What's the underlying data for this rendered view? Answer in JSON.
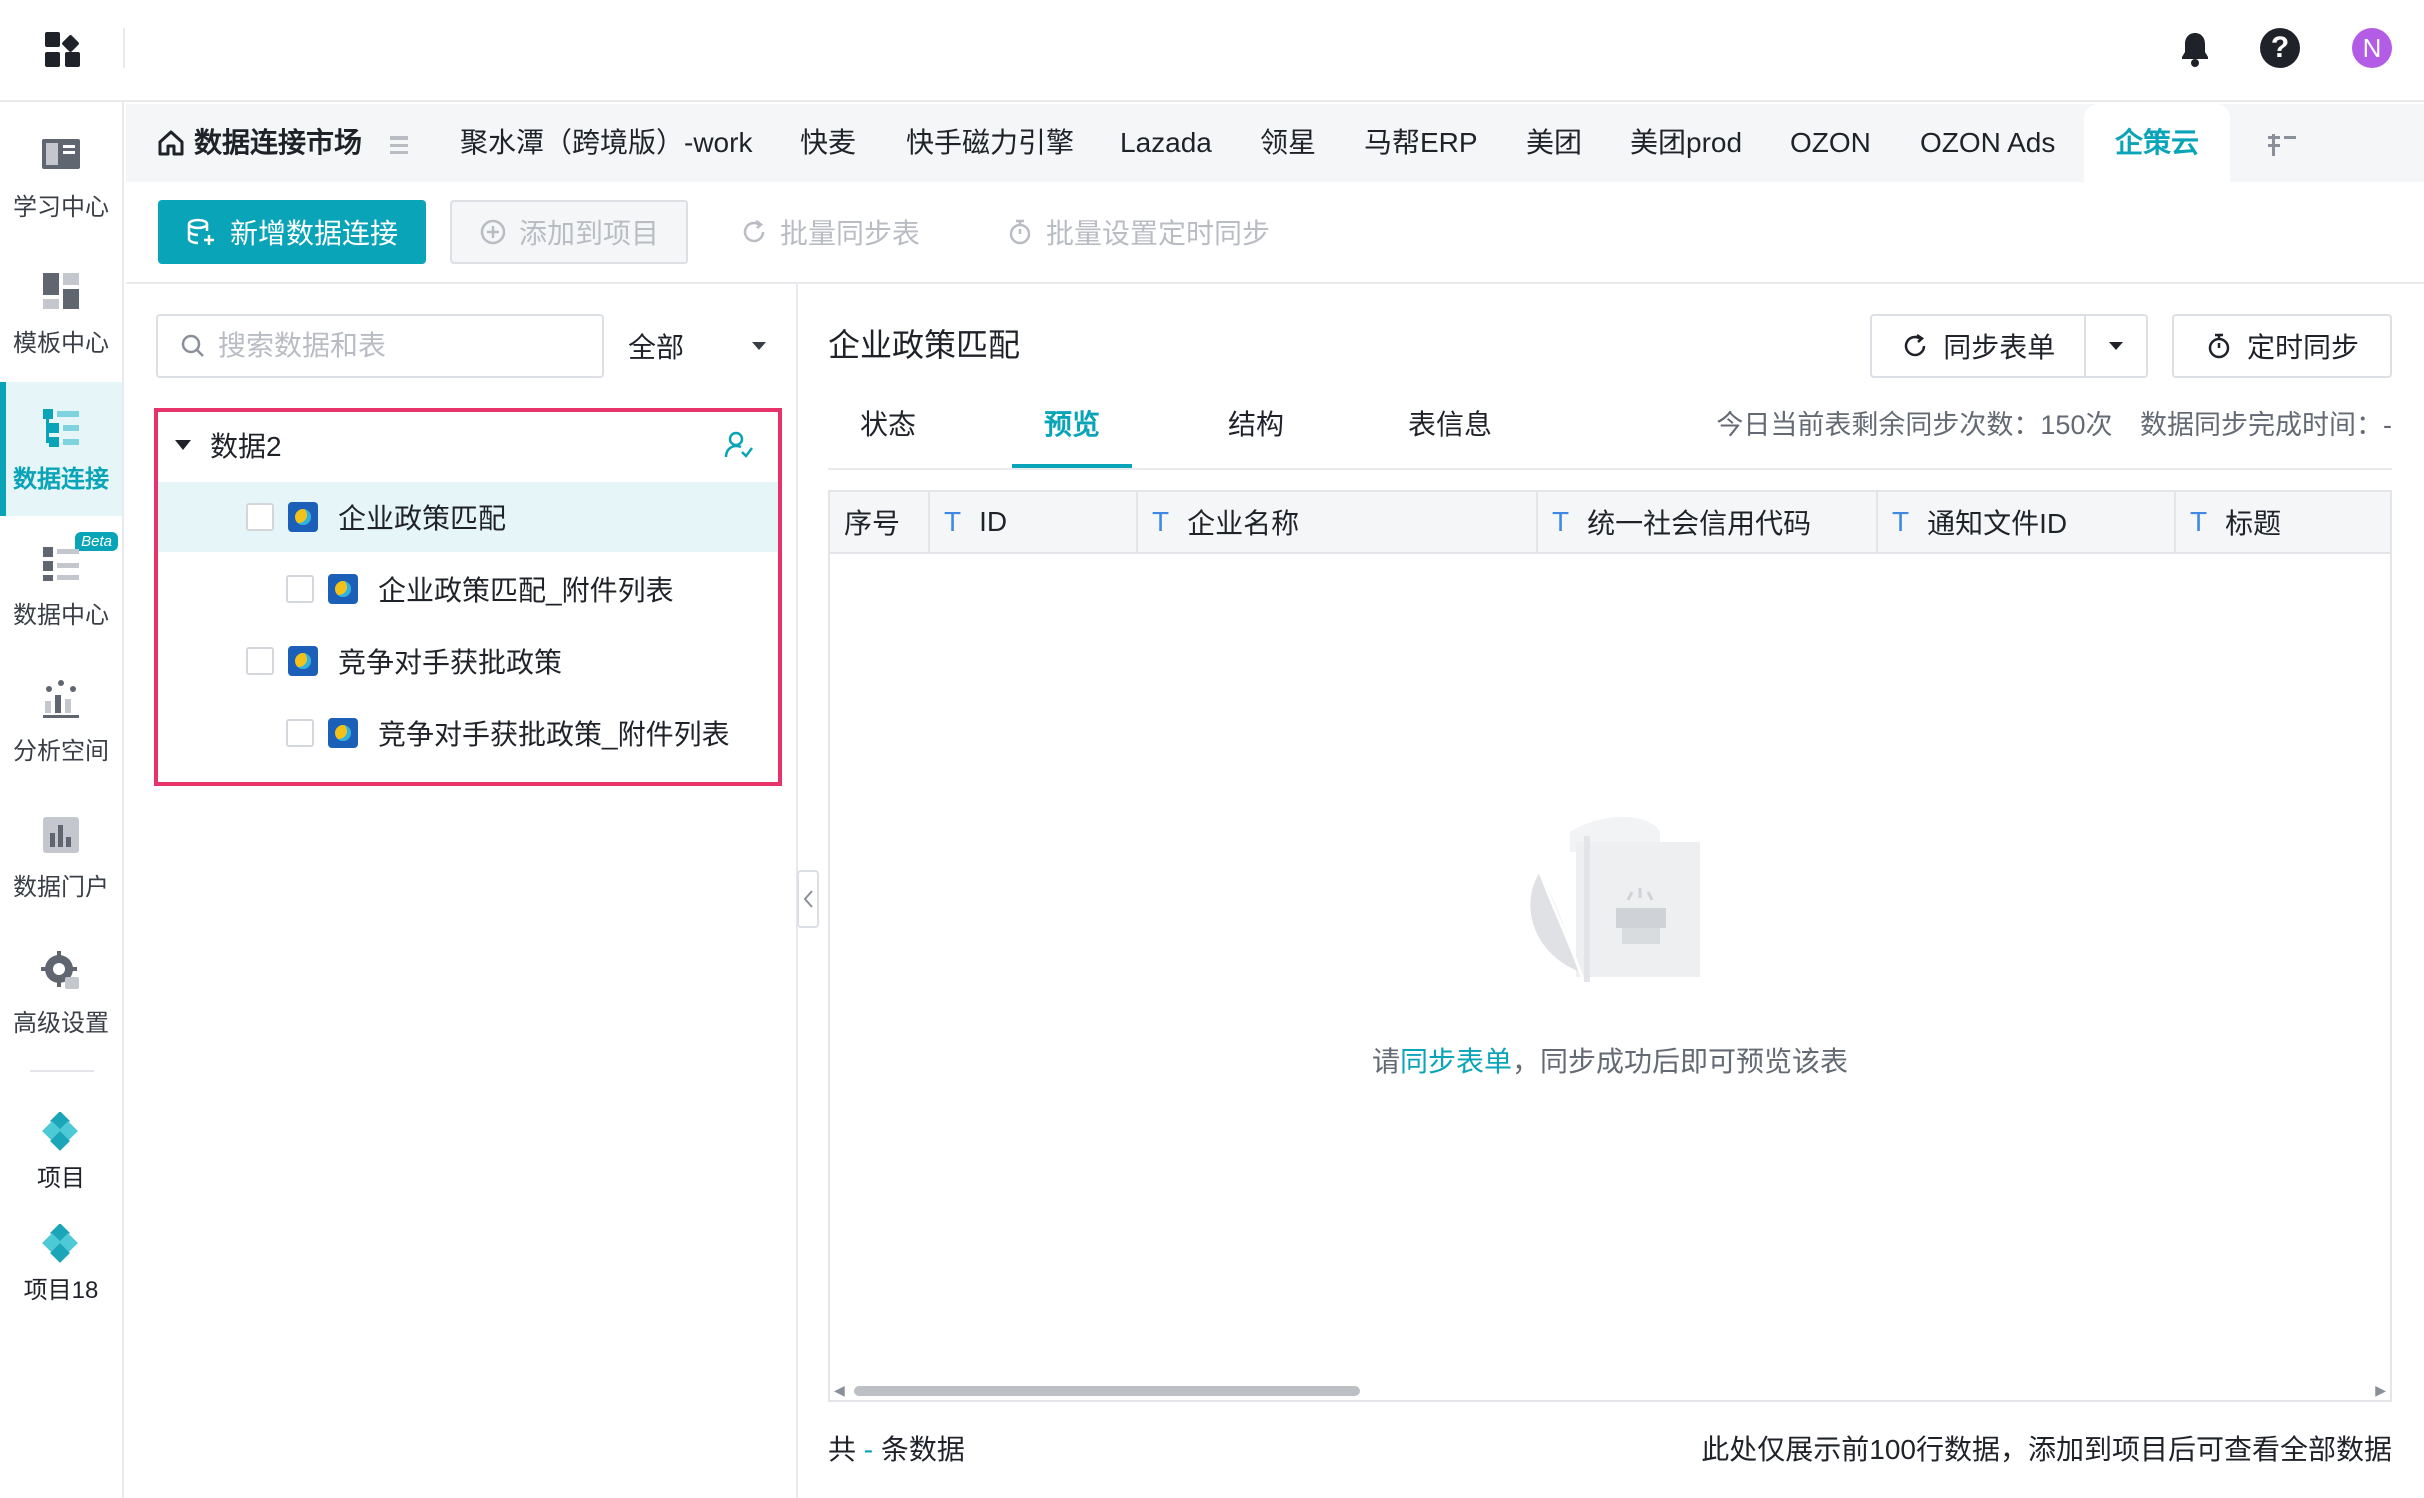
{
  "header": {
    "help_glyph": "?",
    "avatar_initial": "N"
  },
  "sidebar": {
    "items": [
      {
        "label": "学习中心"
      },
      {
        "label": "模板中心"
      },
      {
        "label": "数据连接"
      },
      {
        "label": "数据中心",
        "badge": "Beta"
      },
      {
        "label": "分析空间"
      },
      {
        "label": "数据门户"
      },
      {
        "label": "高级设置"
      }
    ],
    "projects": [
      {
        "label": "项目"
      },
      {
        "label": "项目18"
      }
    ]
  },
  "tabs": {
    "home": "数据连接市场",
    "items": [
      "聚水潭（跨境版）-work",
      "快麦",
      "快手磁力引擎",
      "Lazada",
      "领星",
      "马帮ERP",
      "美团",
      "美团prod",
      "OZON",
      "OZON Ads"
    ],
    "active": "企策云"
  },
  "toolbar": {
    "new_connection": "新增数据连接",
    "add_to_project": "添加到项目",
    "batch_sync": "批量同步表",
    "batch_schedule": "批量设置定时同步"
  },
  "left": {
    "search_placeholder": "搜索数据和表",
    "filter_value": "全部",
    "tree_root": "数据2",
    "tables": [
      "企业政策匹配",
      "企业政策匹配_附件列表",
      "竞争对手获批政策",
      "竞争对手获批政策_附件列表"
    ]
  },
  "detail": {
    "title": "企业政策匹配",
    "sync_button": "同步表单",
    "schedule_button": "定时同步",
    "tabs": [
      "状态",
      "预览",
      "结构",
      "表信息"
    ],
    "remaining_syncs": "今日当前表剩余同步次数：150次",
    "sync_done_time": "数据同步完成时间：-",
    "columns": [
      "序号",
      "ID",
      "企业名称",
      "统一社会信用代码",
      "通知文件ID",
      "标题"
    ],
    "empty_prefix": "请",
    "empty_link": "同步表单",
    "empty_suffix": "，同步成功后即可预览该表",
    "footer_prefix": "共",
    "footer_count": " - ",
    "footer_suffix": "条数据",
    "footer_note": "此处仅展示前100行数据，添加到项目后可查看全部数据"
  },
  "colors": {
    "accent": "#0aa4b8",
    "highlight_border": "#e8336a",
    "avatar": "#b35ce6"
  }
}
